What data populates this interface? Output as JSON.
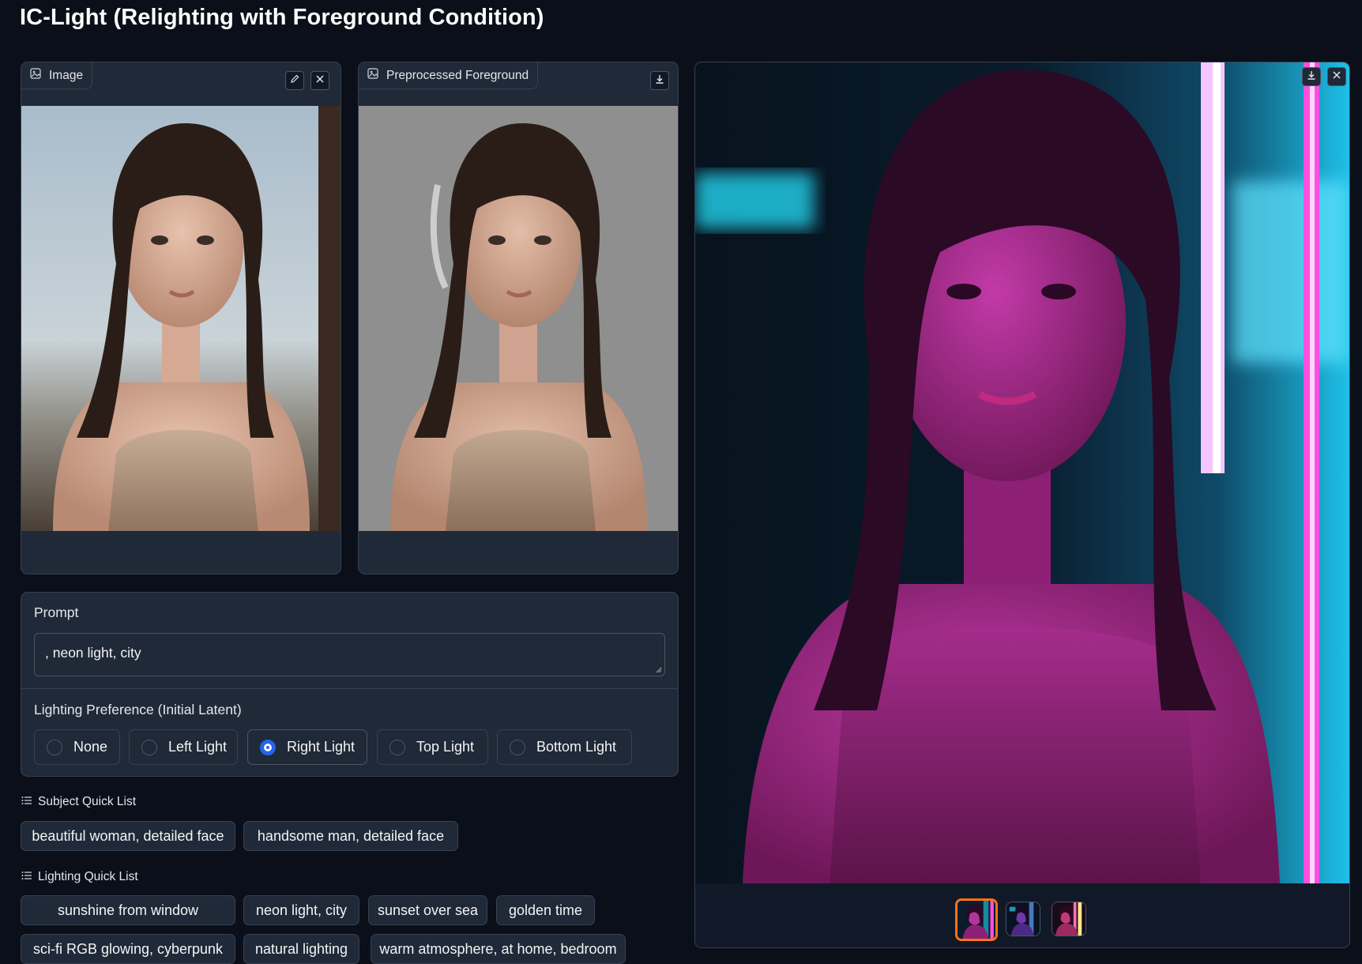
{
  "app": {
    "title": "IC-Light (Relighting with Foreground Condition)"
  },
  "image_input": {
    "label": "Image",
    "icons": [
      "image-icon",
      "edit-icon",
      "close-icon"
    ],
    "alt": "woman in beige tank top, soft window daylight"
  },
  "preprocessed": {
    "label": "Preprocessed Foreground",
    "icons": [
      "image-icon",
      "download-icon"
    ],
    "alt": "same woman on gray background"
  },
  "prompt": {
    "label": "Prompt",
    "value": ", neon light, city"
  },
  "lighting_preference": {
    "label": "Lighting Preference (Initial Latent)",
    "options": [
      "None",
      "Left Light",
      "Right Light",
      "Top Light",
      "Bottom Light"
    ],
    "selected": "Right Light"
  },
  "subject_quick_list": {
    "label": "Subject Quick List",
    "items": [
      "beautiful woman, detailed face",
      "handsome man, detailed face"
    ]
  },
  "lighting_quick_list": {
    "label": "Lighting Quick List",
    "items": [
      "sunshine from window",
      "neon light, city",
      "sunset over sea",
      "golden time",
      "sci-fi RGB glowing, cyberpunk",
      "natural lighting",
      "warm atmosphere, at home, bedroom"
    ]
  },
  "output_gallery": {
    "icons": [
      "download-icon",
      "close-icon"
    ],
    "thumbnail_count": 3,
    "selected_index": 0,
    "colors": {
      "selected_border": "#f97316",
      "neon_pink": "#d946ef",
      "neon_cyan": "#22d3ee"
    }
  },
  "colors": {
    "background": "#0b0f19",
    "panel": "#1f2937",
    "border": "#374151",
    "accent": "#2563eb"
  }
}
